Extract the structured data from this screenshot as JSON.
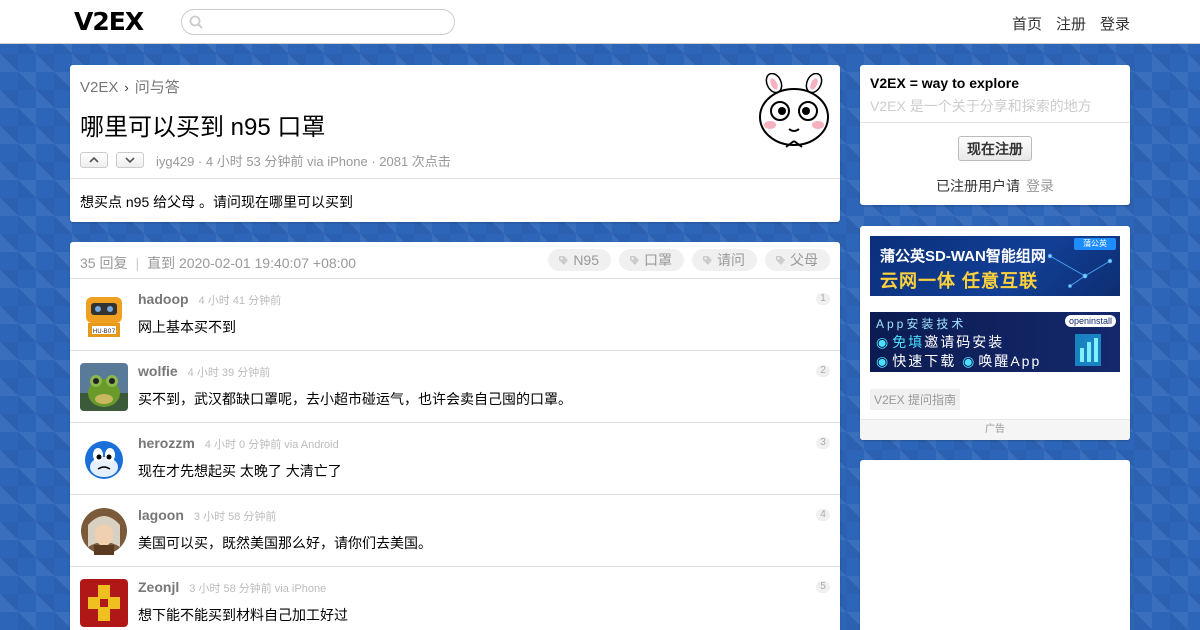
{
  "header": {
    "logo": "V2EX",
    "search": {
      "placeholder": "",
      "value": ""
    },
    "nav": [
      "首页",
      "注册",
      "登录"
    ]
  },
  "topic": {
    "breadcrumb": {
      "site": "V2EX",
      "node": "问与答"
    },
    "title": "哪里可以买到 n95 口罩",
    "meta": "iyg429 · 4 小时 53 分钟前 via iPhone · 2081 次点击",
    "content": "想买点 n95 给父母 。请问现在哪里可以买到"
  },
  "replies_header": {
    "count": "35 回复",
    "until": "直到 2020-02-01 19:40:07 +08:00",
    "tags": [
      "N95",
      "口罩",
      "请问",
      "父母"
    ]
  },
  "replies": [
    {
      "user": "hadoop",
      "time": "4 小时 41 分钟前",
      "body": "网上基本买不到",
      "no": "1"
    },
    {
      "user": "wolfie",
      "time": "4 小时 39 分钟前",
      "body": "买不到，武汉都缺口罩呢，去小超市碰运气，也许会卖自己囤的口罩。",
      "no": "2"
    },
    {
      "user": "herozzm",
      "time": "4 小时 0 分钟前 via Android",
      "body": "现在才先想起买 太晚了 大清亡了",
      "no": "3"
    },
    {
      "user": "lagoon",
      "time": "3 小时 58 分钟前",
      "body": "美国可以买，既然美国那么好，请你们去美国。",
      "no": "4"
    },
    {
      "user": "Zeonjl",
      "time": "3 小时 58 分钟前 via iPhone",
      "body": "想下能不能买到材料自己加工好过",
      "no": "5"
    }
  ],
  "sidebar": {
    "title": "V2EX = way to explore",
    "subtitle": "V2EX 是一个关于分享和探索的地方",
    "register_button": "现在注册",
    "registered_text": "已注册用户请",
    "login_link": "登录"
  },
  "ads": {
    "ad1": {
      "line1": "蒲公英SD-WAN智能组网",
      "line2": "云网一体 任意互联",
      "brand": "蒲公英"
    },
    "ad2": {
      "line1": "App安装技术",
      "line2a": "免填",
      "line2b": "邀请码安装",
      "line3a": "快速下载",
      "line3b": "唤醒App",
      "brand": "openinstall"
    },
    "guide": "V2EX 提问指南",
    "footer": "广告"
  }
}
